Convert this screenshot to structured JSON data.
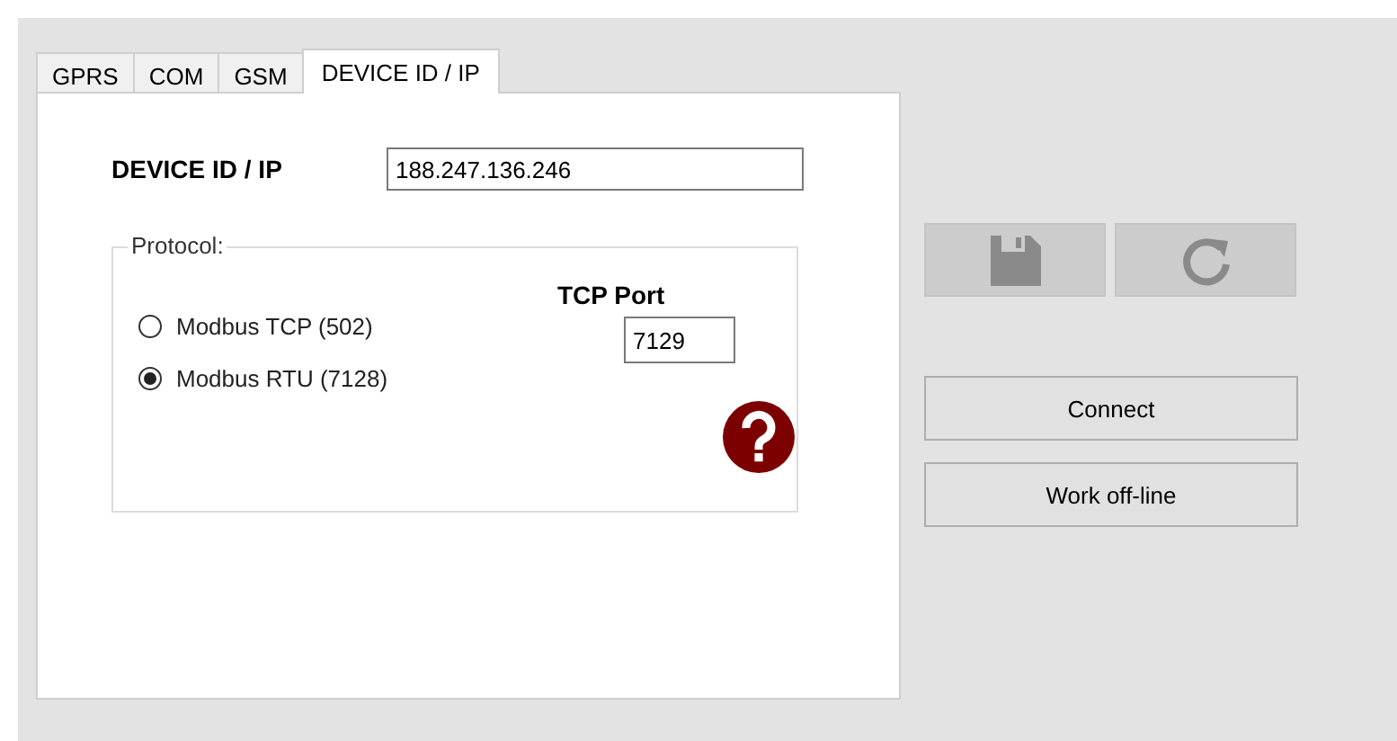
{
  "tabs": [
    {
      "label": "GPRS",
      "selected": false
    },
    {
      "label": "COM",
      "selected": false
    },
    {
      "label": "GSM",
      "selected": false
    },
    {
      "label": "DEVICE ID / IP",
      "selected": true
    }
  ],
  "device_id": {
    "label": "DEVICE ID / IP",
    "value": "188.247.136.246"
  },
  "protocol": {
    "legend": "Protocol:",
    "options": [
      {
        "label": "Modbus TCP (502)",
        "selected": false
      },
      {
        "label": "Modbus RTU (7128)",
        "selected": true
      }
    ],
    "tcp_port": {
      "label": "TCP Port",
      "value": "7129"
    }
  },
  "toolbar": [
    {
      "kind": "save",
      "disabled": true
    },
    {
      "kind": "refresh",
      "disabled": true
    }
  ],
  "buttons": [
    {
      "label": "Connect"
    },
    {
      "label": "Work off-line"
    }
  ]
}
